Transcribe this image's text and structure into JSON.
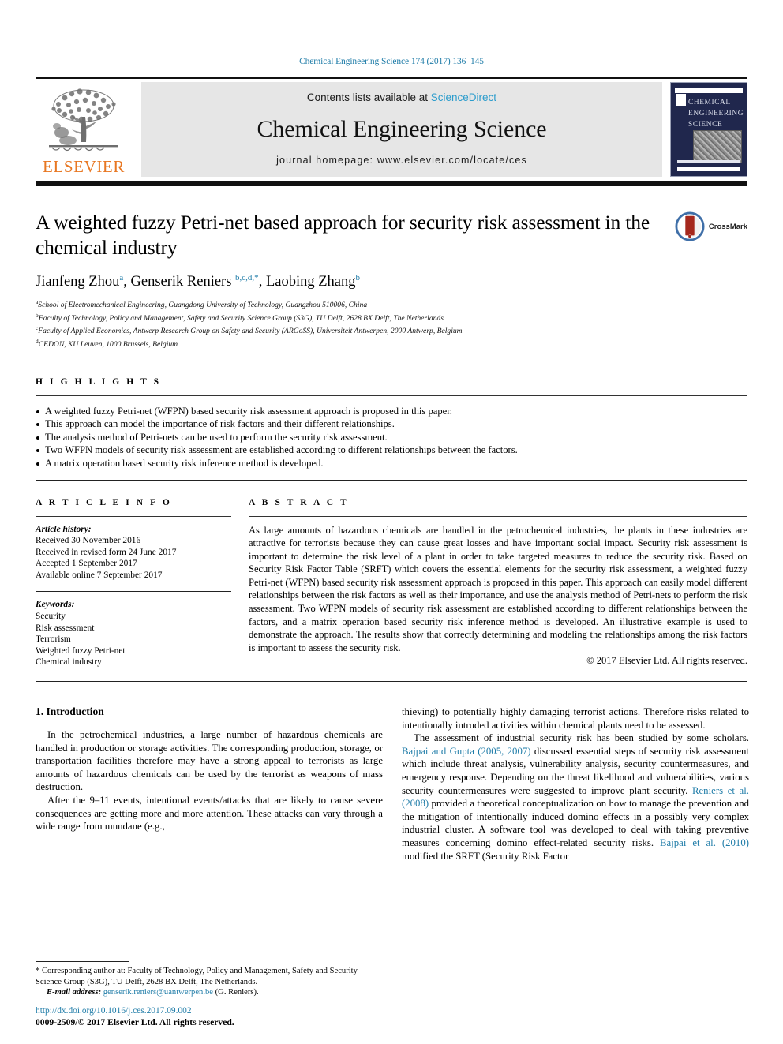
{
  "running_head": "Chemical Engineering Science 174 (2017) 136–145",
  "journal_header": {
    "contents_prefix": "Contents lists available at",
    "sciencedirect": "ScienceDirect",
    "journal_title": "Chemical Engineering Science",
    "homepage": "journal homepage: www.elsevier.com/locate/ces",
    "publisher_logo_text": "ELSEVIER",
    "cover_title_lines": [
      "CHEMICAL",
      "ENGINEERING",
      "SCIENCE"
    ],
    "accent_color": "#2b9ccc",
    "elsevier_orange": "#E87722",
    "cover_navy": "#20274d"
  },
  "article": {
    "title": "A weighted fuzzy Petri-net based approach for security risk assessment in the chemical industry",
    "crossmark_label": "CrossMark",
    "authors": [
      {
        "name": "Jianfeng Zhou",
        "marks": "a"
      },
      {
        "name": "Genserik Reniers",
        "marks": "b,c,d,*"
      },
      {
        "name": "Laobing Zhang",
        "marks": "b"
      }
    ],
    "affiliations": [
      {
        "mark": "a",
        "text": "School of Electromechanical Engineering, Guangdong University of Technology, Guangzhou 510006, China"
      },
      {
        "mark": "b",
        "text": "Faculty of Technology, Policy and Management, Safety and Security Science Group (S3G), TU Delft, 2628 BX Delft, The Netherlands"
      },
      {
        "mark": "c",
        "text": "Faculty of Applied Economics, Antwerp Research Group on Safety and Security (ARGoSS), Universiteit Antwerpen, 2000 Antwerp, Belgium"
      },
      {
        "mark": "d",
        "text": "CEDON, KU Leuven, 1000 Brussels, Belgium"
      }
    ]
  },
  "highlights": {
    "label": "H I G H L I G H T S",
    "items": [
      "A weighted fuzzy Petri-net (WFPN) based security risk assessment approach is proposed in this paper.",
      "This approach can model the importance of risk factors and their different relationships.",
      "The analysis method of Petri-nets can be used to perform the security risk assessment.",
      "Two WFPN models of security risk assessment are established according to different relationships between the factors.",
      "A matrix operation based security risk inference method is developed."
    ]
  },
  "article_info": {
    "label": "A R T I C L E   I N F O",
    "history_label": "Article history:",
    "history": [
      "Received 30 November 2016",
      "Received in revised form 24 June 2017",
      "Accepted 1 September 2017",
      "Available online 7 September 2017"
    ],
    "keywords_label": "Keywords:",
    "keywords": [
      "Security",
      "Risk assessment",
      "Terrorism",
      "Weighted fuzzy Petri-net",
      "Chemical industry"
    ]
  },
  "abstract": {
    "label": "A B S T R A C T",
    "text": "As large amounts of hazardous chemicals are handled in the petrochemical industries, the plants in these industries are attractive for terrorists because they can cause great losses and have important social impact. Security risk assessment is important to determine the risk level of a plant in order to take targeted measures to reduce the security risk. Based on Security Risk Factor Table (SRFT) which covers the essential elements for the security risk assessment, a weighted fuzzy Petri-net (WFPN) based security risk assessment approach is proposed in this paper. This approach can easily model different relationships between the risk factors as well as their importance, and use the analysis method of Petri-nets to perform the risk assessment. Two WFPN models of security risk assessment are established according to different relationships between the factors, and a matrix operation based security risk inference method is developed. An illustrative example is used to demonstrate the approach. The results show that correctly determining and modeling the relationships among the risk factors is important to assess the security risk.",
    "copyright": "© 2017 Elsevier Ltd. All rights reserved."
  },
  "body": {
    "section_heading": "1. Introduction",
    "left_paragraphs": [
      "In the petrochemical industries, a large number of hazardous chemicals are handled in production or storage activities. The corresponding production, storage, or transportation facilities therefore may have a strong appeal to terrorists as large amounts of hazardous chemicals can be used by the terrorist as weapons of mass destruction.",
      "After the 9–11 events, intentional events/attacks that are likely to cause severe consequences are getting more and more attention. These attacks can vary through a wide range from mundane (e.g.,"
    ],
    "right_paragraph_1": "thieving) to potentially highly damaging terrorist actions. Therefore risks related to intentionally intruded activities within chemical plants need to be assessed.",
    "right_paragraph_2_parts": [
      {
        "type": "text",
        "value": "The assessment of industrial security risk has been studied by some scholars. "
      },
      {
        "type": "cite",
        "value": "Bajpai and Gupta (2005, 2007)"
      },
      {
        "type": "text",
        "value": " discussed essential steps of security risk assessment which include threat analysis, vulnerability analysis, security countermeasures, and emergency response. Depending on the threat likelihood and vulnerabilities, various security countermeasures were suggested to improve plant security. "
      },
      {
        "type": "cite",
        "value": "Reniers et al. (2008)"
      },
      {
        "type": "text",
        "value": " provided a theoretical conceptualization on how to manage the prevention and the mitigation of intentionally induced domino effects in a possibly very complex industrial cluster. A software tool was developed to deal with taking preventive measures concerning domino effect-related security risks. "
      },
      {
        "type": "cite",
        "value": "Bajpai et al. (2010)"
      },
      {
        "type": "text",
        "value": " modified the SRFT (Security Risk Factor"
      }
    ]
  },
  "footer": {
    "corresponding_note": "* Corresponding author at: Faculty of Technology, Policy and Management, Safety and Security Science Group (S3G), TU Delft, 2628 BX Delft, The Netherlands.",
    "email_label": "E-mail address:",
    "email": "genserik.reniers@uantwerpen.be",
    "email_owner": "(G. Reniers).",
    "doi": "http://dx.doi.org/10.1016/j.ces.2017.09.002",
    "issn_line": "0009-2509/© 2017 Elsevier Ltd. All rights reserved."
  }
}
